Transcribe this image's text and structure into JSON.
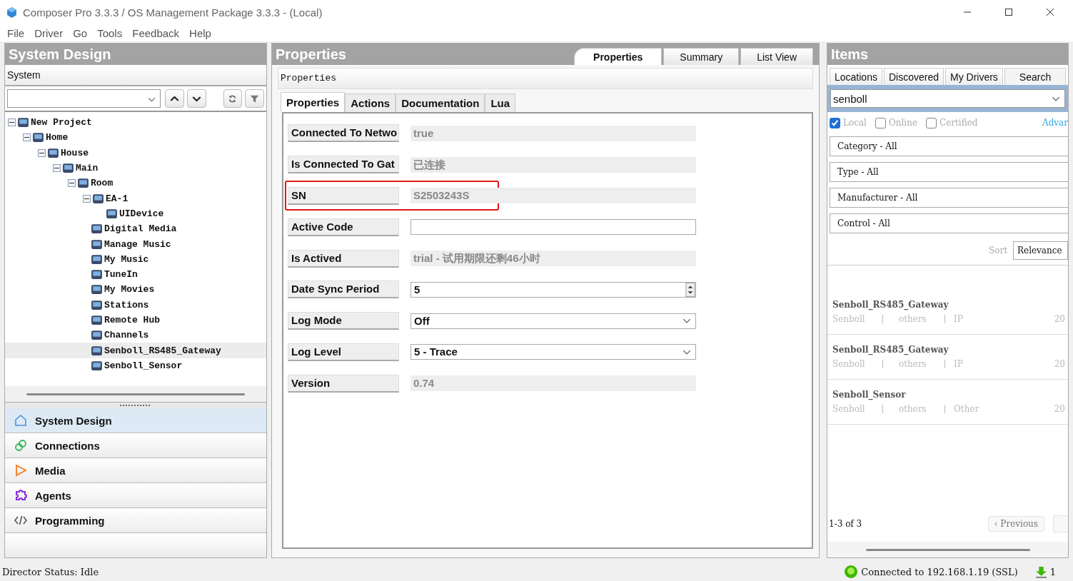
{
  "window": {
    "title": "Composer Pro 3.3.3 / OS Management Package 3.3.3 - (Local)"
  },
  "menu": [
    "File",
    "Driver",
    "Go",
    "Tools",
    "Feedback",
    "Help"
  ],
  "system_design": {
    "title": "System Design",
    "subtitle": "System",
    "tree": [
      {
        "label": "New Project",
        "expanded": true,
        "selected": false,
        "children": [
          {
            "label": "Home",
            "expanded": true,
            "selected": false,
            "children": [
              {
                "label": "House",
                "expanded": true,
                "selected": false,
                "children": [
                  {
                    "label": "Main",
                    "expanded": true,
                    "selected": false,
                    "children": [
                      {
                        "label": "Room",
                        "expanded": true,
                        "selected": false,
                        "children": [
                          {
                            "label": "EA-1",
                            "expanded": true,
                            "selected": false,
                            "children": [
                              {
                                "label": "UIDevice",
                                "selected": false
                              }
                            ]
                          },
                          {
                            "label": "Digital Media",
                            "selected": false
                          },
                          {
                            "label": "Manage Music",
                            "selected": false
                          },
                          {
                            "label": "My Music",
                            "selected": false
                          },
                          {
                            "label": "TuneIn",
                            "selected": false
                          },
                          {
                            "label": "My Movies",
                            "selected": false
                          },
                          {
                            "label": "Stations",
                            "selected": false
                          },
                          {
                            "label": "Remote Hub",
                            "selected": false
                          },
                          {
                            "label": "Channels",
                            "selected": false
                          },
                          {
                            "label": "Senboll_RS485_Gateway",
                            "selected": true
                          },
                          {
                            "label": "Senboll_Sensor",
                            "selected": false
                          }
                        ]
                      }
                    ]
                  }
                ]
              }
            ]
          }
        ]
      }
    ],
    "nav": [
      {
        "label": "System Design",
        "kind": "home",
        "selected": true
      },
      {
        "label": "Connections",
        "kind": "link",
        "selected": false
      },
      {
        "label": "Media",
        "kind": "play",
        "selected": false
      },
      {
        "label": "Agents",
        "kind": "puzzle",
        "selected": false
      },
      {
        "label": "Programming",
        "kind": "code",
        "selected": false
      }
    ]
  },
  "properties": {
    "title": "Properties",
    "view_tabs": [
      {
        "label": "Properties",
        "selected": true
      },
      {
        "label": "Summary",
        "selected": false
      },
      {
        "label": "List View",
        "selected": false
      }
    ],
    "subtitle": "Properties",
    "tabs": [
      {
        "label": "Properties",
        "selected": true
      },
      {
        "label": "Actions",
        "selected": false
      },
      {
        "label": "Documentation",
        "selected": false
      },
      {
        "label": "Lua",
        "selected": false
      }
    ],
    "rows": [
      {
        "label": "Connected To Netwo",
        "kind": "readonly",
        "value": "true",
        "highlighted": false
      },
      {
        "label": "Is Connected To Gat",
        "kind": "readonly",
        "value": "已连接",
        "highlighted": false
      },
      {
        "label": "SN",
        "kind": "readonly",
        "value": "S2503243S",
        "highlighted": true
      },
      {
        "label": "Active Code",
        "kind": "text",
        "highlighted": false
      },
      {
        "label": "Is Actived",
        "kind": "readonly",
        "value": "trial - 试用期限还剩46小时",
        "highlighted": false
      },
      {
        "label": "Date Sync Period",
        "kind": "spin",
        "value": "5",
        "highlighted": false
      },
      {
        "label": "Log Mode",
        "kind": "select",
        "value": "Off",
        "highlighted": false
      },
      {
        "label": "Log Level",
        "kind": "select",
        "value": "5 - Trace",
        "highlighted": false
      },
      {
        "label": "Version",
        "kind": "readonly",
        "value": "0.74",
        "highlighted": false
      }
    ]
  },
  "items": {
    "title": "Items",
    "tabs": [
      {
        "label": "Locations",
        "selected": false
      },
      {
        "label": "Discovered",
        "selected": false
      },
      {
        "label": "My Drivers",
        "selected": false
      },
      {
        "label": "Search",
        "selected": true
      }
    ],
    "search": {
      "value": "senboll"
    },
    "checkboxes": [
      {
        "label": "Local",
        "checked": true
      },
      {
        "label": "Online",
        "checked": false
      },
      {
        "label": "Certified",
        "checked": false
      }
    ],
    "advanced_link": "Advar",
    "filters": [
      "Category - All",
      "Type - All",
      "Manufacturer - All",
      "Control - All"
    ],
    "sort": {
      "label": "Sort",
      "value": "Relevance"
    },
    "results": [
      {
        "name": "Senboll_RS485_Gateway",
        "manufacturer": "Senboll",
        "category": "others",
        "type": "IP",
        "date": "20"
      },
      {
        "name": "Senboll_RS485_Gateway",
        "manufacturer": "Senboll",
        "category": "others",
        "type": "IP",
        "date": "20"
      },
      {
        "name": "Senboll_Sensor",
        "manufacturer": "Senboll",
        "category": "others",
        "type": "Other",
        "date": "20"
      }
    ],
    "count": "1-3 of 3",
    "previous": "‹ Previous"
  },
  "status_bar": {
    "director": "Director Status: Idle",
    "connection": "Connected to 192.168.1.19 (SSL)",
    "downloads": "1"
  }
}
